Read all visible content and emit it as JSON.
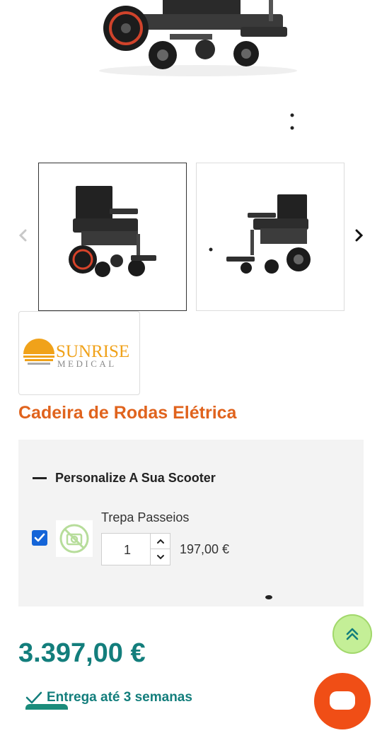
{
  "product": {
    "title": "Cadeira de Rodas Elétrica",
    "price": "3.397,00 €",
    "delivery": "Entrega até 3 semanas"
  },
  "gallery": {
    "brand_logo_top": "SUNRISE",
    "brand_logo_bottom": "MEDICAL"
  },
  "options": {
    "section_title": "Personalize A Sua Scooter",
    "items": [
      {
        "name": "Trepa Passeios",
        "quantity": "1",
        "price": "197,00 €",
        "checked": true
      }
    ]
  },
  "colors": {
    "title": "#e0631d",
    "price": "#137e7c",
    "chat": "#f04e16",
    "scroll_top": "#c4ef97"
  },
  "icons": {
    "prev": "chevron-left-icon",
    "next": "chevron-right-icon",
    "scroll_top": "double-chevron-up-icon",
    "delivery": "check-icon",
    "qty_up": "chevron-up-icon",
    "qty_down": "chevron-down-icon",
    "no_image": "no-camera-icon"
  }
}
